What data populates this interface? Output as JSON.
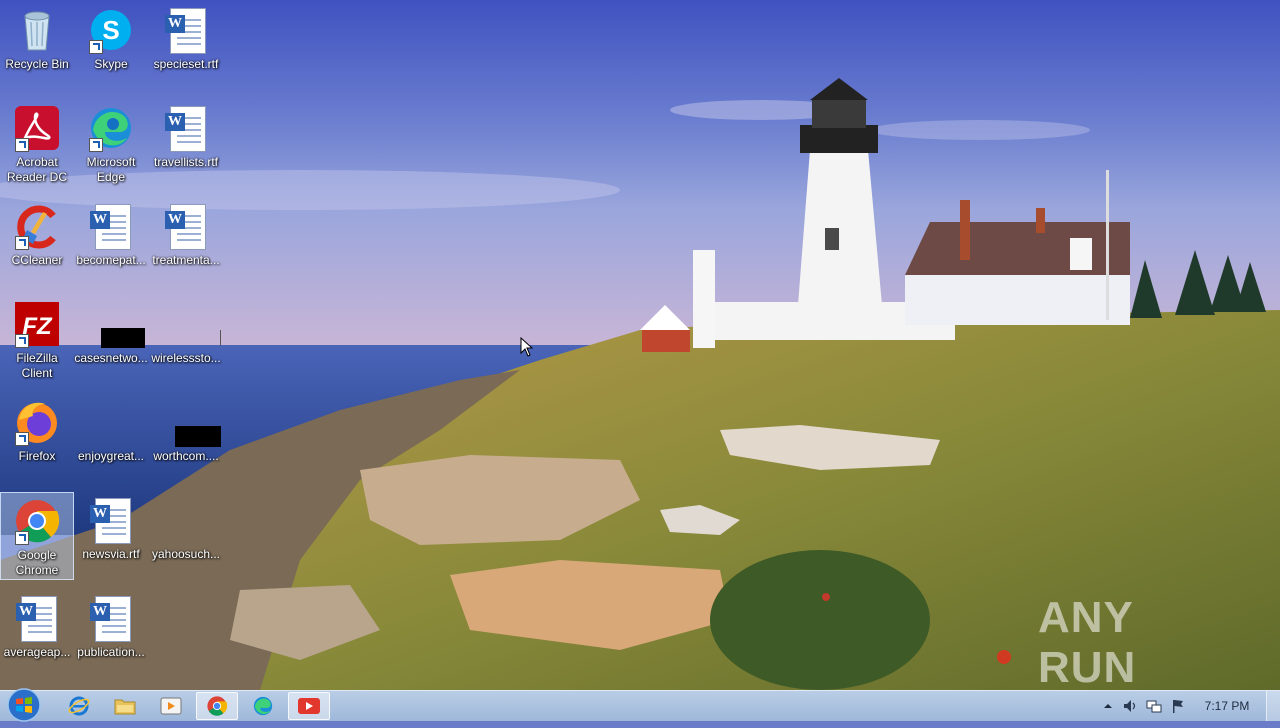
{
  "desktop": {
    "icons": [
      {
        "label": "Recycle Bin"
      },
      {
        "label": "Skype"
      },
      {
        "label": "specieset.rtf"
      },
      {
        "label": "Acrobat Reader DC"
      },
      {
        "label": "Microsoft Edge"
      },
      {
        "label": "travellists.rtf"
      },
      {
        "label": "CCleaner"
      },
      {
        "label": "becomepat..."
      },
      {
        "label": "treatmenta..."
      },
      {
        "label": "FileZilla Client"
      },
      {
        "label": "casesnetwo..."
      },
      {
        "label": "wirelesssto..."
      },
      {
        "label": "Firefox"
      },
      {
        "label": "enjoygreat..."
      },
      {
        "label": "worthcom...."
      },
      {
        "label": "Google Chrome"
      },
      {
        "label": "newsvia.rtf"
      },
      {
        "label": "yahoosuch..."
      },
      {
        "label": "averageap..."
      },
      {
        "label": "publication..."
      }
    ],
    "watermark": "ANY RUN"
  },
  "taskbar": {
    "pinned": [
      {
        "icon": "internet-explorer-icon"
      },
      {
        "icon": "file-explorer-icon"
      },
      {
        "icon": "media-player-icon"
      },
      {
        "icon": "chrome-icon"
      },
      {
        "icon": "edge-icon"
      },
      {
        "icon": "anyrun-icon"
      }
    ],
    "clock": "7:17 PM"
  },
  "colors": {
    "taskbar": "#a9c0df",
    "sky": "#5c6fc4",
    "sea": "#2e4e9a"
  }
}
